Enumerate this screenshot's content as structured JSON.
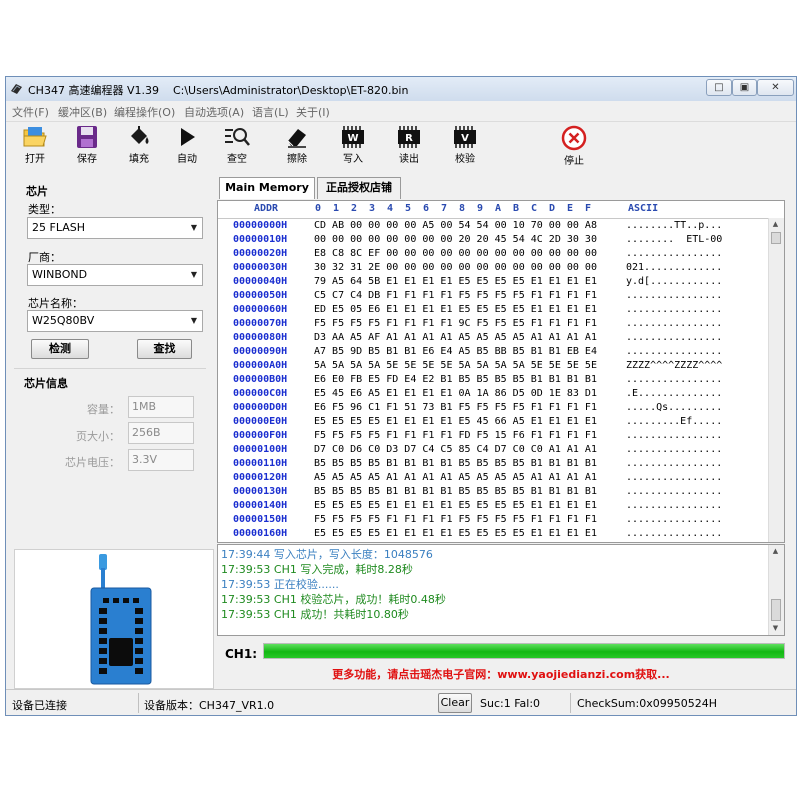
{
  "window": {
    "app_name": "CH347 高速编程器 V1.39",
    "file_path": "C:\\Users\\Administrator\\Desktop\\ET-820.bin",
    "minimize_glyph": "□",
    "maximize_glyph": "▣",
    "close_glyph": "✕"
  },
  "menu": [
    "文件(F)",
    "缓冲区(B)",
    "编程操作(O)",
    "自动选项(A)",
    "语言(L)",
    "关于(I)"
  ],
  "toolbar": {
    "open": "打开",
    "save": "保存",
    "fill": "填充",
    "auto": "自动",
    "check": "查空",
    "erase": "擦除",
    "write": "写入",
    "read": "读出",
    "verify": "校验",
    "stop": "停止",
    "write_tag": "W",
    "read_tag": "R",
    "verify_tag": "V"
  },
  "chip": {
    "section_title": "芯片",
    "type_label": "类型：",
    "type_value": "25 FLASH",
    "vendor_label": "厂商：",
    "vendor_value": "WINBOND",
    "name_label": "芯片名称：",
    "name_value": "W25Q80BV",
    "detect_button": "检测",
    "search_button": "查找",
    "arrow": "▼"
  },
  "chip_info": {
    "section_title": "芯片信息",
    "capacity_label": "容量：",
    "capacity_value": "1MB",
    "page_label": "页大小：",
    "page_value": "256B",
    "voltage_label": "芯片电压：",
    "voltage_value": "3.3V"
  },
  "tabs": [
    "Main Memory",
    "正品授权店铺"
  ],
  "hex": {
    "addr_header": "ADDR",
    "col_headers": [
      "0",
      "1",
      "2",
      "3",
      "4",
      "5",
      "6",
      "7",
      "8",
      "9",
      "A",
      "B",
      "C",
      "D",
      "E",
      "F"
    ],
    "ascii_header": "ASCII",
    "rows": [
      {
        "addr": "00000000H",
        "bytes": "CD AB 00 00 00 00 A5 00 54 54 00 10 70 00 00 A8",
        "ascii": "........TT..p..."
      },
      {
        "addr": "00000010H",
        "bytes": "00 00 00 00 00 00 00 00 20 20 45 54 4C 2D 30 30",
        "ascii": "........  ETL-00"
      },
      {
        "addr": "00000020H",
        "bytes": "E8 C8 8C EF 00 00 00 00 00 00 00 00 00 00 00 00",
        "ascii": "................"
      },
      {
        "addr": "00000030H",
        "bytes": "30 32 31 2E 00 00 00 00 00 00 00 00 00 00 00 00",
        "ascii": "021............."
      },
      {
        "addr": "00000040H",
        "bytes": "79 A5 64 5B E1 E1 E1 E1 E5 E5 E5 E5 E1 E1 E1 E1",
        "ascii": "y.d[............"
      },
      {
        "addr": "00000050H",
        "bytes": "C5 C7 C4 DB F1 F1 F1 F1 F5 F5 F5 F5 F1 F1 F1 F1",
        "ascii": "................"
      },
      {
        "addr": "00000060H",
        "bytes": "ED E5 05 E6 E1 E1 E1 E1 E5 E5 E5 E5 E1 E1 E1 E1",
        "ascii": "................"
      },
      {
        "addr": "00000070H",
        "bytes": "F5 F5 F5 F5 F1 F1 F1 F1 9C F5 F5 E5 F1 F1 F1 F1",
        "ascii": "................"
      },
      {
        "addr": "00000080H",
        "bytes": "D3 AA A5 AF A1 A1 A1 A1 A5 A5 A5 A5 A1 A1 A1 A1",
        "ascii": "................"
      },
      {
        "addr": "00000090H",
        "bytes": "A7 B5 9D B5 B1 B1 E6 E4 A5 B5 BB B5 B1 B1 EB E4",
        "ascii": "................"
      },
      {
        "addr": "000000A0H",
        "bytes": "5A 5A 5A 5A 5E 5E 5E 5E 5A 5A 5A 5A 5E 5E 5E 5E",
        "ascii": "ZZZZ^^^^ZZZZ^^^^"
      },
      {
        "addr": "000000B0H",
        "bytes": "E6 E0 FB E5 FD E4 E2 B1 B5 B5 B5 B5 B1 B1 B1 B1",
        "ascii": "................"
      },
      {
        "addr": "000000C0H",
        "bytes": "E5 45 E6 A5 E1 E1 E1 E1 0A 1A 86 D5 0D 1E 83 D1",
        "ascii": ".E.............."
      },
      {
        "addr": "000000D0H",
        "bytes": "E6 F5 96 C1 F1 51 73 B1 F5 F5 F5 F5 F1 F1 F1 F1",
        "ascii": ".....Qs........."
      },
      {
        "addr": "000000E0H",
        "bytes": "E5 E5 E5 E5 E1 E1 E1 E1 E5 45 66 A5 E1 E1 E1 E1",
        "ascii": ".........Ef....."
      },
      {
        "addr": "000000F0H",
        "bytes": "F5 F5 F5 F5 F1 F1 F1 F1 FD F5 15 F6 F1 F1 F1 F1",
        "ascii": "................"
      },
      {
        "addr": "00000100H",
        "bytes": "D7 C0 D6 C0 D3 D7 C4 C5 85 C4 D7 C0 C0 A1 A1 A1",
        "ascii": "................"
      },
      {
        "addr": "00000110H",
        "bytes": "B5 B5 B5 B5 B1 B1 B1 B1 B5 B5 B5 B5 B1 B1 B1 B1",
        "ascii": "................"
      },
      {
        "addr": "00000120H",
        "bytes": "A5 A5 A5 A5 A1 A1 A1 A1 A5 A5 A5 A5 A1 A1 A1 A1",
        "ascii": "................"
      },
      {
        "addr": "00000130H",
        "bytes": "B5 B5 B5 B5 B1 B1 B1 B1 B5 B5 B5 B5 B1 B1 B1 B1",
        "ascii": "................"
      },
      {
        "addr": "00000140H",
        "bytes": "E5 E5 E5 E5 E1 E1 E1 E1 E5 E5 E5 E5 E1 E1 E1 E1",
        "ascii": "................"
      },
      {
        "addr": "00000150H",
        "bytes": "F5 F5 F5 F5 F1 F1 F1 F1 F5 F5 F5 F5 F1 F1 F1 F1",
        "ascii": "................"
      },
      {
        "addr": "00000160H",
        "bytes": "E5 E5 E5 E5 E1 E1 E1 E1 E5 E5 E5 E5 E1 E1 E1 E1",
        "ascii": "................"
      }
    ]
  },
  "log": [
    {
      "text": "17:39:44 写入芯片，写入长度：1048576",
      "color": "#3a7fc0"
    },
    {
      "text": "17:39:53 CH1 写入完成，耗时8.28秒",
      "color": "#1f8a1f"
    },
    {
      "text": "17:39:53 正在校验......",
      "color": "#3a7fc0"
    },
    {
      "text": "17:39:53 CH1 校验芯片，成功！耗时0.48秒",
      "color": "#1f8a1f"
    },
    {
      "text": "17:39:53 CH1 成功！共耗时10.80秒",
      "color": "#1f8a1f"
    }
  ],
  "progress": {
    "label": "CH1:",
    "percent": 100
  },
  "promo": "更多功能，请点击瑶杰电子官网：www.yaojiedianzi.com获取...",
  "status": {
    "connection": "设备已连接",
    "device_version": "设备版本：CH347_VR1.0",
    "clear_button": "Clear",
    "suc_fal": "Suc:1  Fal:0",
    "checksum": "CheckSum:0x09950524H"
  },
  "colors": {
    "accent_blue": "#1a2ed0",
    "progress_green": "#14b814",
    "promo_red": "#e01010",
    "stop_red": "#d42020",
    "board_blue": "#2a7fd0"
  }
}
